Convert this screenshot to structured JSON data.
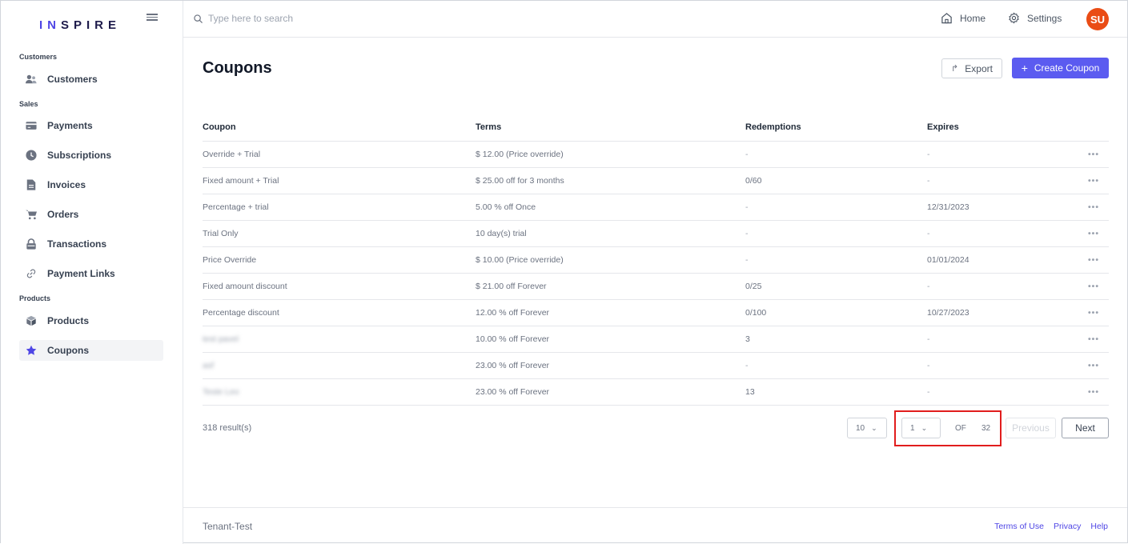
{
  "brand": {
    "logo_prefix": "IN",
    "logo_suffix": "SPIRE",
    "accent": "#5b5bf0"
  },
  "search": {
    "placeholder": "Type here to search"
  },
  "topnav": {
    "home": "Home",
    "settings": "Settings",
    "avatar": "SU"
  },
  "sidebar": {
    "sections": {
      "customers": "Customers",
      "sales": "Sales",
      "products": "Products"
    },
    "items": [
      {
        "label": "Customers",
        "icon": "users-icon"
      },
      {
        "label": "Payments",
        "icon": "card-icon"
      },
      {
        "label": "Subscriptions",
        "icon": "clock-icon"
      },
      {
        "label": "Invoices",
        "icon": "document-icon"
      },
      {
        "label": "Orders",
        "icon": "cart-icon"
      },
      {
        "label": "Transactions",
        "icon": "lock-icon"
      },
      {
        "label": "Payment Links",
        "icon": "link-icon"
      },
      {
        "label": "Products",
        "icon": "box-icon"
      },
      {
        "label": "Coupons",
        "icon": "star-icon",
        "active": true
      }
    ]
  },
  "main": {
    "title": "Coupons",
    "export_label": "Export",
    "create_label": "Create Coupon",
    "table": {
      "headers": [
        "Coupon",
        "Terms",
        "Redemptions",
        "Expires"
      ],
      "rows": [
        [
          "Override + Trial",
          "$ 12.00 (Price override)",
          "-",
          "-"
        ],
        [
          "Fixed amount + Trial",
          "$ 25.00 off for 3 months",
          "0/60",
          "-"
        ],
        [
          "Percentage + trial",
          "5.00 % off Once",
          "-",
          "12/31/2023"
        ],
        [
          "Trial Only",
          "10 day(s) trial",
          "-",
          "-"
        ],
        [
          "Price Override",
          "$ 10.00 (Price override)",
          "-",
          "01/01/2024"
        ],
        [
          "Fixed amount discount",
          "$ 21.00 off Forever",
          "0/25",
          "-"
        ],
        [
          "Percentage discount",
          "12.00 % off Forever",
          "0/100",
          "10/27/2023"
        ],
        [
          "test pavel",
          "10.00 % off Forever",
          "3",
          "-"
        ],
        [
          "asf",
          "23.00 % off Forever",
          "-",
          "-"
        ],
        [
          "Teste Leo",
          "23.00 % off Forever",
          "13",
          "-"
        ]
      ],
      "row_action": "•••"
    },
    "pagination": {
      "results": "318 result(s)",
      "page_size": "10",
      "page": "1",
      "of_label": "OF",
      "total_pages": "32",
      "previous": "Previous",
      "next": "Next"
    }
  },
  "footer": {
    "tenant": "Tenant-Test",
    "links": [
      "Terms of Use",
      "Privacy",
      "Help"
    ]
  }
}
